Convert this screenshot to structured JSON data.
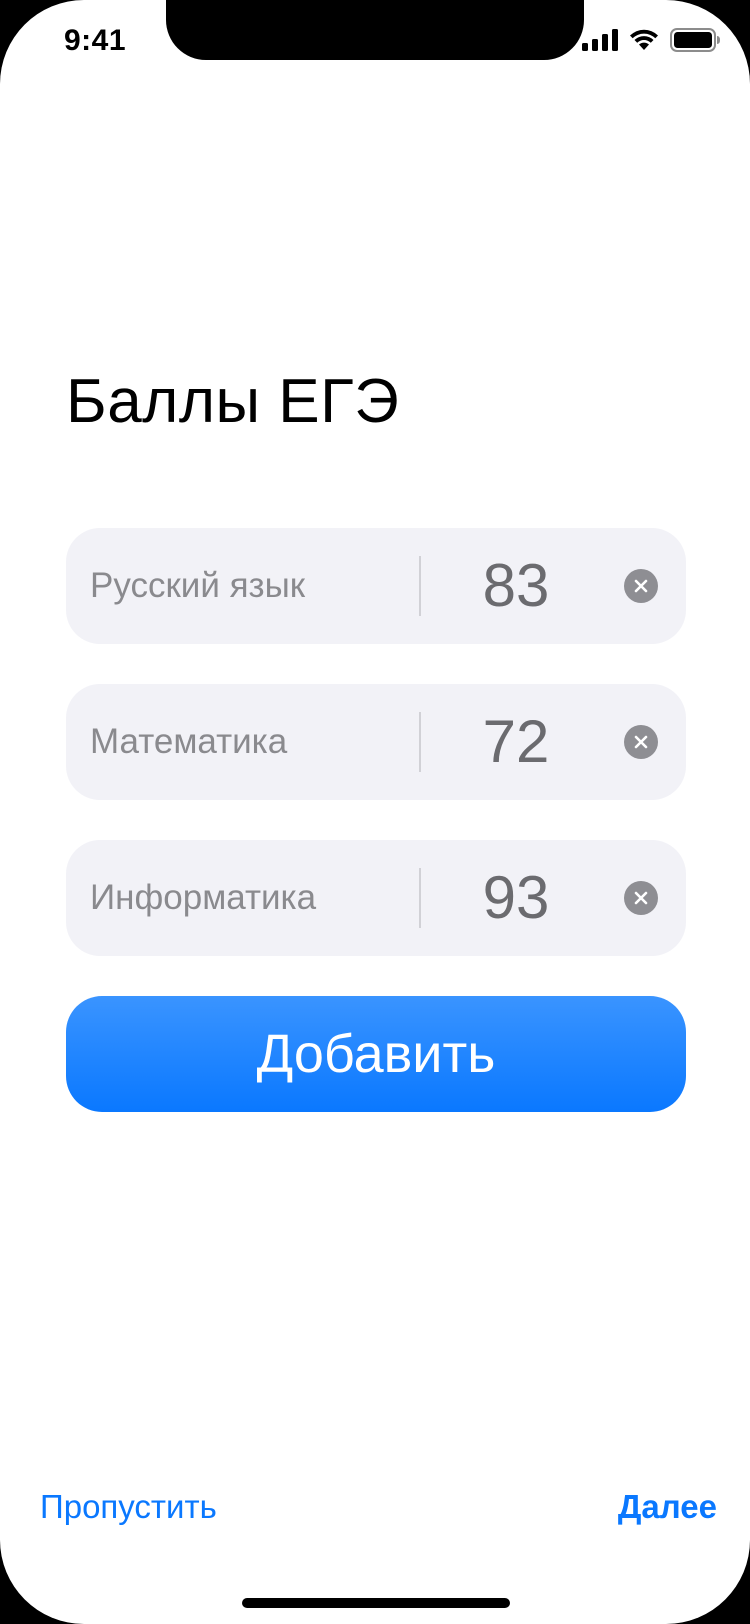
{
  "status_bar": {
    "time": "9:41",
    "icons": [
      "cellular-signal-icon",
      "wifi-icon",
      "battery-icon"
    ]
  },
  "page": {
    "title": "Баллы ЕГЭ"
  },
  "scores": [
    {
      "subject": "Русский язык",
      "value": "83"
    },
    {
      "subject": "Математика",
      "value": "72"
    },
    {
      "subject": "Информатика",
      "value": "93"
    }
  ],
  "actions": {
    "add_label": "Добавить",
    "skip_label": "Пропустить",
    "next_label": "Далее"
  },
  "colors": {
    "accent": "#0A78FF",
    "field_background": "#F2F2F7",
    "label_gray": "#8A8A8E",
    "clear_icon": "#8E8E93"
  }
}
